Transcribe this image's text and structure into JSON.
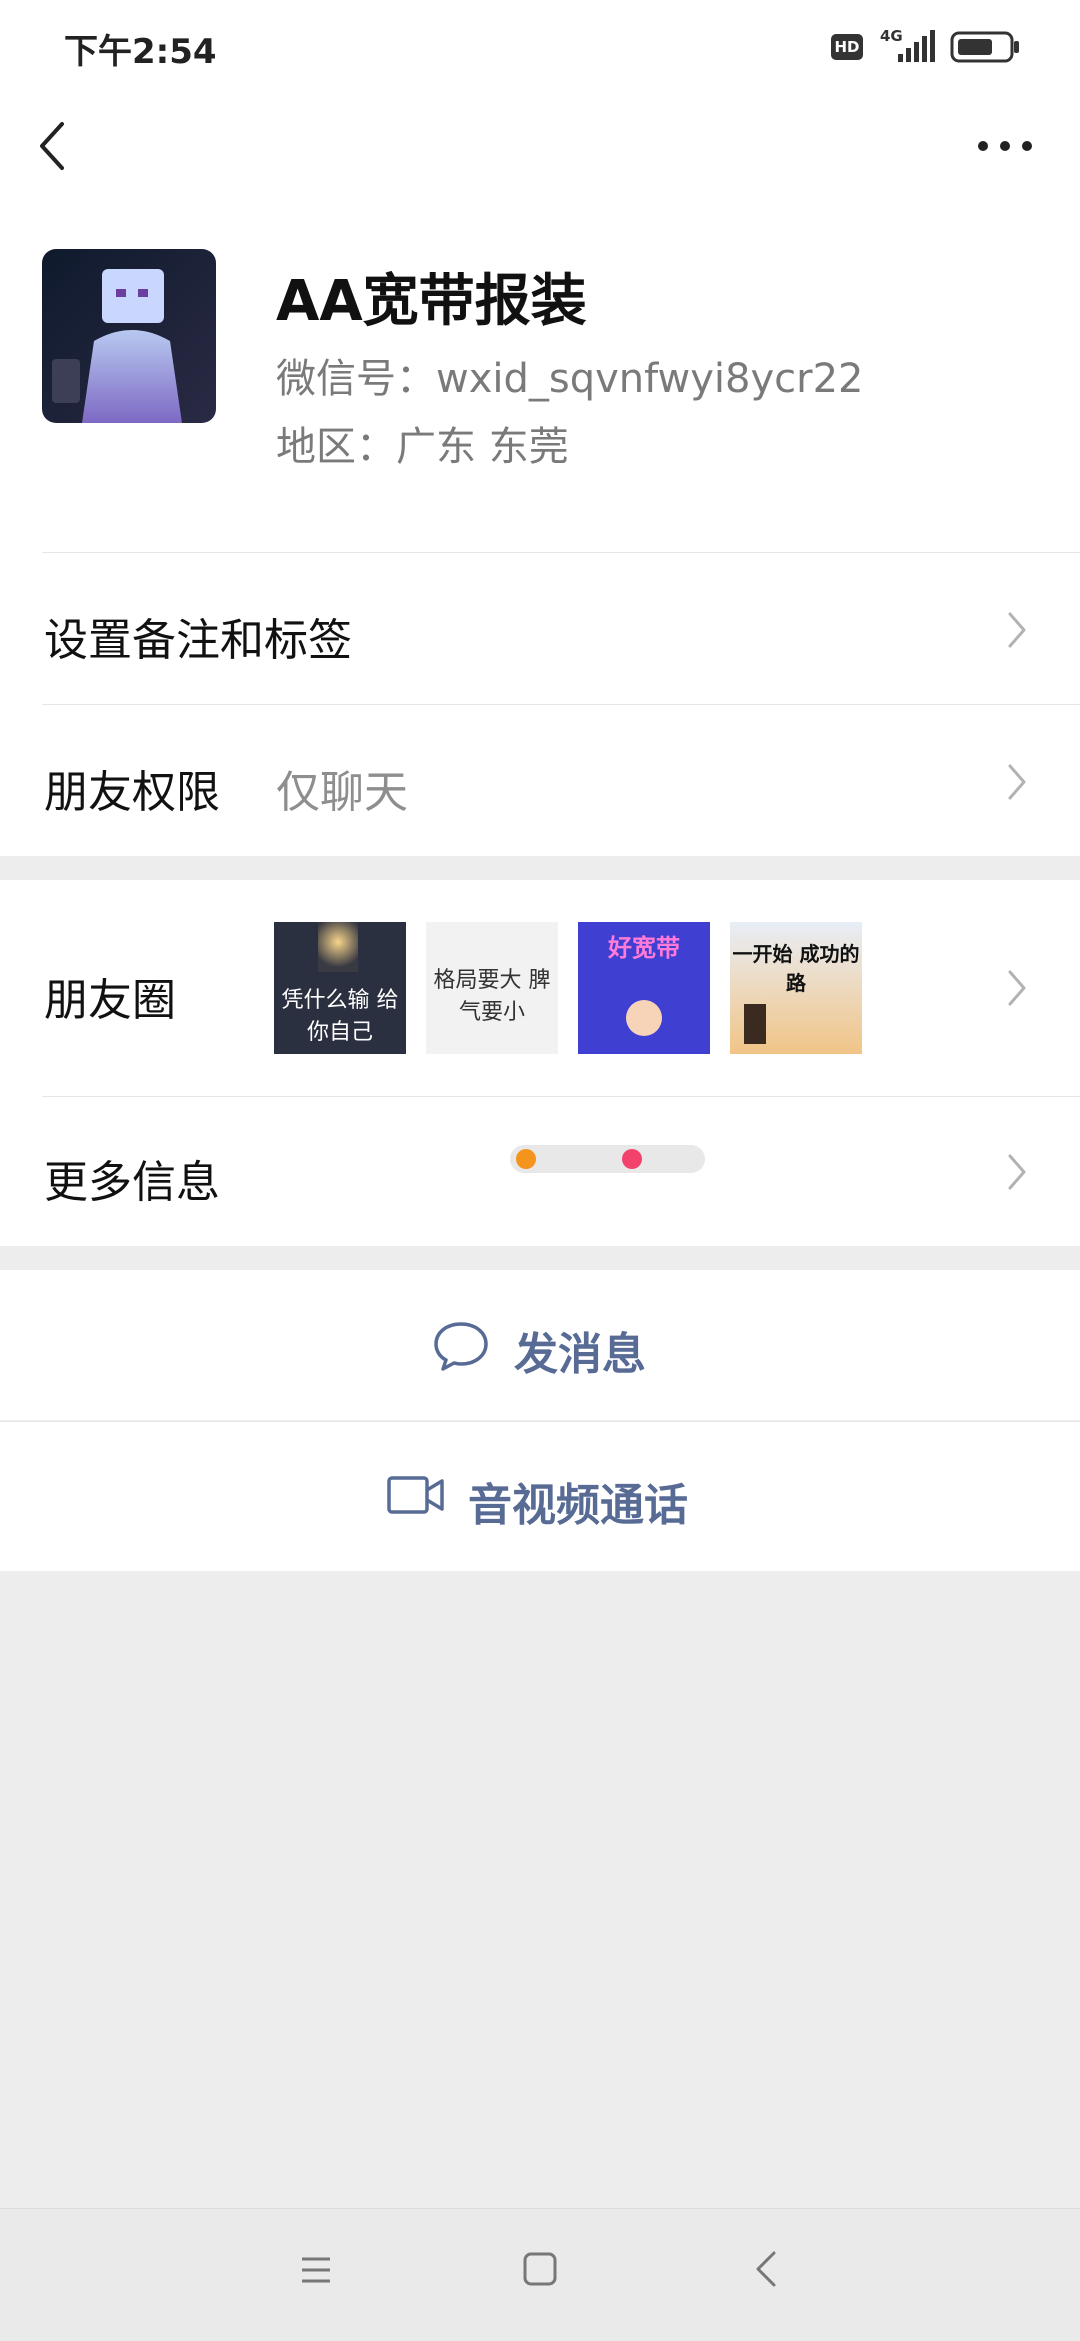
{
  "status_bar": {
    "time": "下午2:54",
    "hd_label": "HD",
    "network_label": "4G",
    "signal_icon": "cellular-signal-icon",
    "battery_icon": "battery-icon"
  },
  "nav": {
    "back_icon": "chevron-left-icon",
    "more_icon": "more-dots-icon"
  },
  "profile": {
    "name": "AA宽带报装",
    "wechat_id": "微信号：wxid_sqvnfwyi8ycr22",
    "region": "地区：广东  东莞",
    "avatar_icon": "avatar-image"
  },
  "rows": {
    "remark_label": "设置备注和标签",
    "permission_label": "朋友权限",
    "permission_value": "仅聊天",
    "moments_label": "朋友圈",
    "more_info_label": "更多信息"
  },
  "moments_thumbs": [
    {
      "text": "凭什么输 给你自己"
    },
    {
      "text": "格局要大 脾气要小"
    },
    {
      "text": "好宽带"
    },
    {
      "text": "一开始 成功的路"
    }
  ],
  "actions": {
    "message_label": "发消息",
    "message_icon": "chat-bubble-icon",
    "call_label": "音视频通话",
    "call_icon": "video-camera-icon"
  },
  "system_nav": {
    "menu_icon": "menu-icon",
    "home_icon": "home-square-icon",
    "back_icon": "back-triangle-icon"
  },
  "colors": {
    "accent": "#576b95",
    "page_bg": "#ededed"
  }
}
